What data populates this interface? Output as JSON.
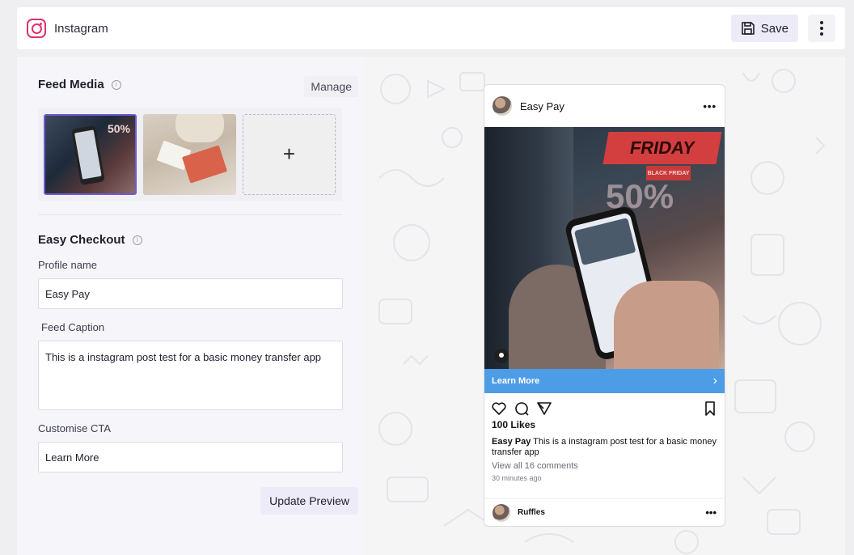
{
  "header": {
    "app_title": "Instagram",
    "logo_icon": "instagram-icon",
    "save_label": "Save",
    "more_icon": "more-vertical-icon"
  },
  "feed_media": {
    "title": "Feed Media",
    "info_icon": "info-icon",
    "manage_label": "Manage",
    "add_label": "+",
    "thumbnails": [
      {
        "name": "phone-sale-photo",
        "selected": true
      },
      {
        "name": "gift-box-photo",
        "selected": false
      }
    ]
  },
  "checkout": {
    "title": "Easy Checkout",
    "profile_label": "Profile name",
    "profile_value": "Easy Pay",
    "caption_label": "Feed Caption",
    "caption_value": "This is a instagram post test for a basic money transfer app",
    "cta_label": "Customise CTA",
    "cta_value": "Learn More",
    "update_label": "Update Preview"
  },
  "preview": {
    "profile_name": "Easy Pay",
    "menu_dots": "•••",
    "image_texts": {
      "banner": "FRIDAY",
      "sub": "BLACK FRIDAY",
      "big": "50%"
    },
    "cta_text": "Learn More",
    "cta_chevron": "›",
    "likes": "100 Likes",
    "caption_user": "Easy Pay",
    "caption_text": " This is a instagram post test for a basic money transfer app",
    "comments_link": "View all 16 comments",
    "time_ago": "30 minutes ago",
    "commenter": "Ruffles",
    "accent": "#4d9de6"
  }
}
